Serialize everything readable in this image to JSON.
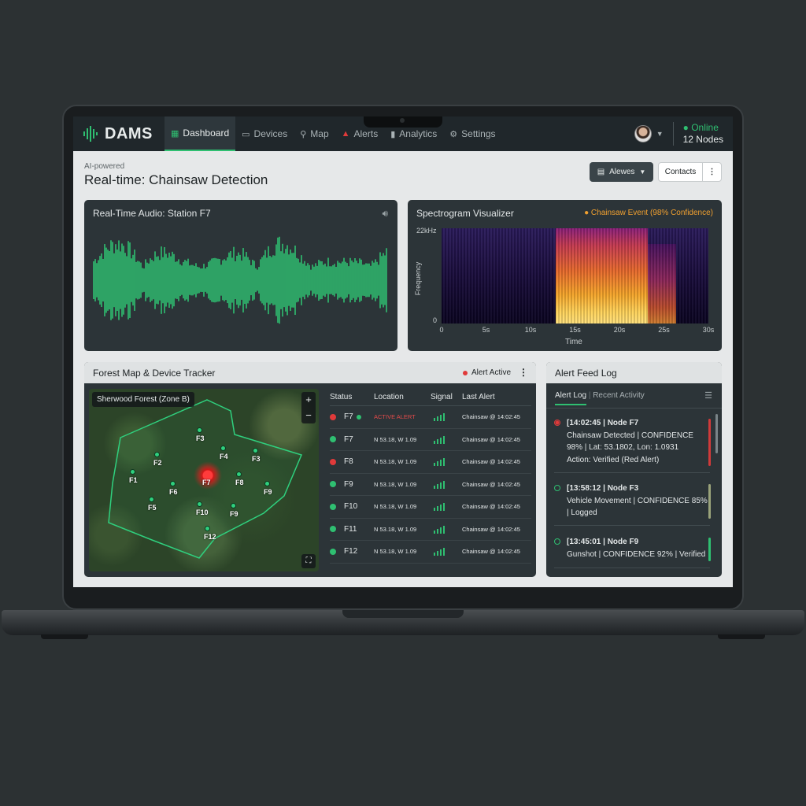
{
  "app": {
    "brand": "DAMS"
  },
  "nav": {
    "items": [
      {
        "label": "Dashboard",
        "icon": "grid-icon",
        "active": true
      },
      {
        "label": "Devices",
        "icon": "monitor-icon",
        "active": false
      },
      {
        "label": "Map",
        "icon": "map-pin-icon",
        "active": false
      },
      {
        "label": "Alerts",
        "icon": "warning-icon",
        "active": false
      },
      {
        "label": "Analytics",
        "icon": "bar-chart-icon",
        "active": false
      },
      {
        "label": "Settings",
        "icon": "gear-icon",
        "active": false
      }
    ],
    "status": "Online",
    "nodes": "12 Nodes"
  },
  "header": {
    "subtitle": "AI-powered",
    "title": "Real-time: Chainsaw Detection",
    "alewes_label": "Alewes",
    "contacts_label": "Contacts"
  },
  "audio": {
    "title": "Real-Time Audio: Station F7"
  },
  "spectrogram": {
    "title": "Spectrogram Visualizer",
    "event": "Chainsaw Event (98% Confidence)",
    "y_top": "22kHz",
    "y_bottom": "0",
    "ylabel": "Frequency",
    "xlabel": "Time",
    "x_ticks": [
      "0",
      "5s",
      "10s",
      "15s",
      "20s",
      "25s",
      "30s"
    ]
  },
  "map_panel": {
    "title": "Forest Map & Device Tracker",
    "alert_status": "Alert Active",
    "map_label": "Sherwood Forest (Zone B)",
    "zoom_in": "+",
    "zoom_out": "−",
    "hot_node": "F7",
    "nodes": [
      {
        "label": "F3"
      },
      {
        "label": "F2"
      },
      {
        "label": "F4"
      },
      {
        "label": "F3"
      },
      {
        "label": "F1"
      },
      {
        "label": "F6"
      },
      {
        "label": "F8"
      },
      {
        "label": "F9"
      },
      {
        "label": "F5"
      },
      {
        "label": "F10"
      },
      {
        "label": "F9"
      },
      {
        "label": "F12"
      }
    ],
    "columns": [
      "Status",
      "Location",
      "Signal",
      "Last Alert"
    ],
    "rows": [
      {
        "node": "F7",
        "status": "red",
        "extra_dot": true,
        "location": "ACTIVE ALERT",
        "alert": true,
        "last": "Chainsaw @ 14:02:45"
      },
      {
        "node": "F7",
        "status": "green",
        "location": "N 53.18, W 1.09",
        "last": "Chainsaw @ 14:02:45"
      },
      {
        "node": "F8",
        "status": "red",
        "location": "N 53.18, W 1.09",
        "last": "Chainsaw @ 14:02:45"
      },
      {
        "node": "F9",
        "status": "green",
        "location": "N 53.18, W 1.09",
        "last": "Chainsaw @ 14:02:45"
      },
      {
        "node": "F10",
        "status": "green",
        "location": "N 53.18, W 1.09",
        "last": "Chainsaw @ 14:02:45"
      },
      {
        "node": "F11",
        "status": "green",
        "location": "N 53.18, W 1.09",
        "last": "Chainsaw @ 14:02:45"
      },
      {
        "node": "F12",
        "status": "green",
        "location": "N 53.18, W 1.09",
        "last": "Chainsaw @ 14:02:45"
      }
    ]
  },
  "feed": {
    "title": "Alert Feed Log",
    "tab_active": "Alert Log",
    "tab_other": "Recent Activity",
    "entries": [
      {
        "head": "[14:02:45 | Node F7",
        "lines": [
          "Chainsaw Detected | CONFIDENCE",
          "98% | Lat: 53.1802, Lon: 1.0931",
          "Action: Verified (Red Alert)"
        ],
        "color": "#d03a3a",
        "level": "red"
      },
      {
        "head": "[13:58:12 | Node F3",
        "lines": [
          "Vehicle Movement | CONFIDENCE 85%",
          "| Logged"
        ],
        "color": "#9aa37a",
        "level": "green"
      },
      {
        "head": "[13:45:01 | Node F9",
        "lines": [
          "Gunshot | CONFIDENCE 92% | Verified"
        ],
        "color": "#2fbf71",
        "level": "green"
      }
    ]
  },
  "colors": {
    "accent": "#2fbf71",
    "alert": "#e03a3a",
    "warning": "#f0a030"
  }
}
